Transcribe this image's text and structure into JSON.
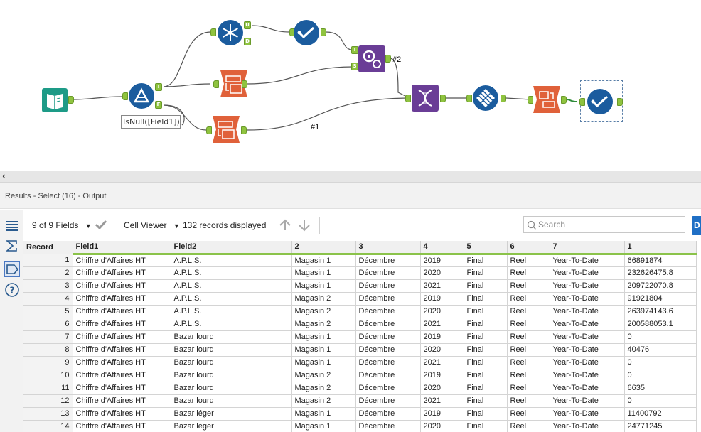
{
  "canvas": {
    "formula_label": "IsNull([Field1])",
    "union_labels": [
      "#2",
      "#1"
    ],
    "anchor_letters": {
      "true": "T",
      "false": "F",
      "unique": "U",
      "dupes": "D",
      "target": "T",
      "source": "S"
    }
  },
  "results": {
    "title": "Results - Select (16) - Output"
  },
  "toolbar": {
    "fields_label": "9 of 9 Fields",
    "viewer_label": "Cell Viewer",
    "records_label": "132 records displayed",
    "search_placeholder": "Search",
    "d_button": "D"
  },
  "table": {
    "columns": [
      "Record",
      "Field1",
      "Field2",
      "2",
      "3",
      "4",
      "5",
      "6",
      "7",
      "1"
    ],
    "rows": [
      [
        "1",
        "Chiffre d'Affaires HT",
        "A.P.L.S.",
        "Magasin 1",
        "Décembre",
        "2019",
        "Final",
        "Reel",
        "Year-To-Date",
        "66891874"
      ],
      [
        "2",
        "Chiffre d'Affaires HT",
        "A.P.L.S.",
        "Magasin 1",
        "Décembre",
        "2020",
        "Final",
        "Reel",
        "Year-To-Date",
        "232626475.8"
      ],
      [
        "3",
        "Chiffre d'Affaires HT",
        "A.P.L.S.",
        "Magasin 1",
        "Décembre",
        "2021",
        "Final",
        "Reel",
        "Year-To-Date",
        "209722070.8"
      ],
      [
        "4",
        "Chiffre d'Affaires HT",
        "A.P.L.S.",
        "Magasin 2",
        "Décembre",
        "2019",
        "Final",
        "Reel",
        "Year-To-Date",
        "91921804"
      ],
      [
        "5",
        "Chiffre d'Affaires HT",
        "A.P.L.S.",
        "Magasin 2",
        "Décembre",
        "2020",
        "Final",
        "Reel",
        "Year-To-Date",
        "263974143.6"
      ],
      [
        "6",
        "Chiffre d'Affaires HT",
        "A.P.L.S.",
        "Magasin 2",
        "Décembre",
        "2021",
        "Final",
        "Reel",
        "Year-To-Date",
        "200588053.1"
      ],
      [
        "7",
        "Chiffre d'Affaires HT",
        "Bazar lourd",
        "Magasin 1",
        "Décembre",
        "2019",
        "Final",
        "Reel",
        "Year-To-Date",
        "0"
      ],
      [
        "8",
        "Chiffre d'Affaires HT",
        "Bazar lourd",
        "Magasin 1",
        "Décembre",
        "2020",
        "Final",
        "Reel",
        "Year-To-Date",
        "40476"
      ],
      [
        "9",
        "Chiffre d'Affaires HT",
        "Bazar lourd",
        "Magasin 1",
        "Décembre",
        "2021",
        "Final",
        "Reel",
        "Year-To-Date",
        "0"
      ],
      [
        "10",
        "Chiffre d'Affaires HT",
        "Bazar lourd",
        "Magasin 2",
        "Décembre",
        "2019",
        "Final",
        "Reel",
        "Year-To-Date",
        "0"
      ],
      [
        "11",
        "Chiffre d'Affaires HT",
        "Bazar lourd",
        "Magasin 2",
        "Décembre",
        "2020",
        "Final",
        "Reel",
        "Year-To-Date",
        "6635"
      ],
      [
        "12",
        "Chiffre d'Affaires HT",
        "Bazar lourd",
        "Magasin 2",
        "Décembre",
        "2021",
        "Final",
        "Reel",
        "Year-To-Date",
        "0"
      ],
      [
        "13",
        "Chiffre d'Affaires HT",
        "Bazar léger",
        "Magasin 1",
        "Décembre",
        "2019",
        "Final",
        "Reel",
        "Year-To-Date",
        "11400792"
      ],
      [
        "14",
        "Chiffre d'Affaires HT",
        "Bazar léger",
        "Magasin 1",
        "Décembre",
        "2020",
        "Final",
        "Reel",
        "Year-To-Date",
        "24771245"
      ]
    ]
  },
  "colors": {
    "tool_blue": "#1b5c9e",
    "tool_teal": "#1d9b87",
    "tool_purple": "#6a3d96",
    "tool_orange": "#e0613a",
    "anchor_green": "#8fc33f",
    "header_underline": "#8bc34a"
  }
}
